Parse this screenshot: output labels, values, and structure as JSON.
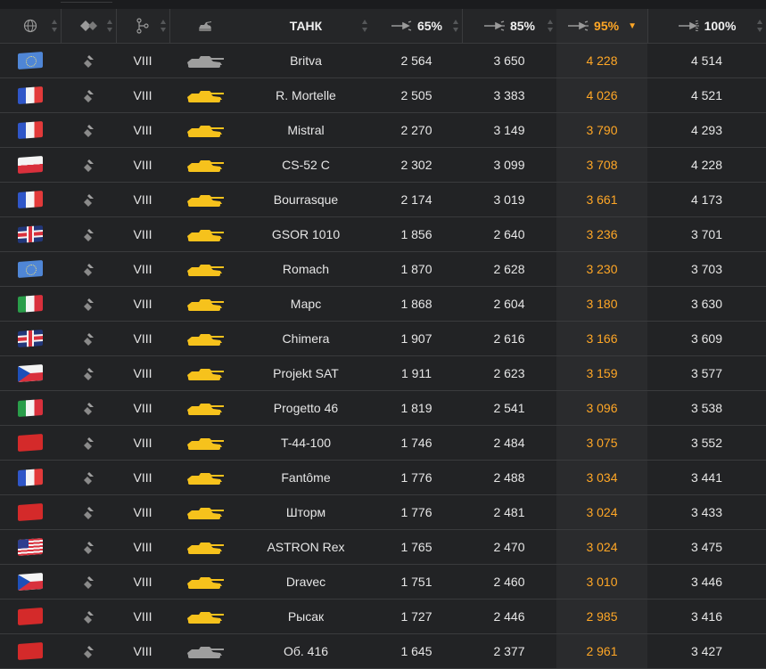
{
  "header": {
    "tank_label": "ТАНК",
    "col_65": "65%",
    "col_85": "85%",
    "col_95": "95%",
    "col_100": "100%",
    "sort_indicator": "▼"
  },
  "icons": {
    "nation": "globe-icon",
    "type": "tank-type-icon",
    "tier": "tech-tree-icon",
    "vehicle": "tank-silhouette-icon",
    "mark": "gun-mark-icon",
    "class": "medium-tank-chevron-icon"
  },
  "colors": {
    "accent": "#ffa726",
    "tank_gold": "#f6c21c",
    "tank_grey": "#9e9e9e",
    "row_bg": "#222325",
    "highlight_col_bg": "#2a2b2d"
  },
  "rows": [
    {
      "nation": "eu",
      "tier": "VIII",
      "name": "Britva",
      "v65": "2 564",
      "v85": "3 650",
      "v95": "4 228",
      "v100": "4 514",
      "premium": false
    },
    {
      "nation": "fr",
      "tier": "VIII",
      "name": "R. Mortelle",
      "v65": "2 505",
      "v85": "3 383",
      "v95": "4 026",
      "v100": "4 521",
      "premium": true
    },
    {
      "nation": "fr",
      "tier": "VIII",
      "name": "Mistral",
      "v65": "2 270",
      "v85": "3 149",
      "v95": "3 790",
      "v100": "4 293",
      "premium": true
    },
    {
      "nation": "pl",
      "tier": "VIII",
      "name": "CS-52 C",
      "v65": "2 302",
      "v85": "3 099",
      "v95": "3 708",
      "v100": "4 228",
      "premium": true
    },
    {
      "nation": "fr",
      "tier": "VIII",
      "name": "Bourrasque",
      "v65": "2 174",
      "v85": "3 019",
      "v95": "3 661",
      "v100": "4 173",
      "premium": true
    },
    {
      "nation": "uk",
      "tier": "VIII",
      "name": "GSOR 1010",
      "v65": "1 856",
      "v85": "2 640",
      "v95": "3 236",
      "v100": "3 701",
      "premium": true
    },
    {
      "nation": "eu",
      "tier": "VIII",
      "name": "Romach",
      "v65": "1 870",
      "v85": "2 628",
      "v95": "3 230",
      "v100": "3 703",
      "premium": true
    },
    {
      "nation": "it",
      "tier": "VIII",
      "name": "Марс",
      "v65": "1 868",
      "v85": "2 604",
      "v95": "3 180",
      "v100": "3 630",
      "premium": true
    },
    {
      "nation": "uk",
      "tier": "VIII",
      "name": "Chimera",
      "v65": "1 907",
      "v85": "2 616",
      "v95": "3 166",
      "v100": "3 609",
      "premium": true
    },
    {
      "nation": "cz",
      "tier": "VIII",
      "name": "Projekt SAT",
      "v65": "1 911",
      "v85": "2 623",
      "v95": "3 159",
      "v100": "3 577",
      "premium": true
    },
    {
      "nation": "it",
      "tier": "VIII",
      "name": "Progetto 46",
      "v65": "1 819",
      "v85": "2 541",
      "v95": "3 096",
      "v100": "3 538",
      "premium": true
    },
    {
      "nation": "ussr",
      "tier": "VIII",
      "name": "T-44-100",
      "v65": "1 746",
      "v85": "2 484",
      "v95": "3 075",
      "v100": "3 552",
      "premium": true
    },
    {
      "nation": "fr",
      "tier": "VIII",
      "name": "Fantôme",
      "v65": "1 776",
      "v85": "2 488",
      "v95": "3 034",
      "v100": "3 441",
      "premium": true
    },
    {
      "nation": "ussr",
      "tier": "VIII",
      "name": "Шторм",
      "v65": "1 776",
      "v85": "2 481",
      "v95": "3 024",
      "v100": "3 433",
      "premium": true
    },
    {
      "nation": "us",
      "tier": "VIII",
      "name": "ASTRON Rex",
      "v65": "1 765",
      "v85": "2 470",
      "v95": "3 024",
      "v100": "3 475",
      "premium": true
    },
    {
      "nation": "cz",
      "tier": "VIII",
      "name": "Dravec",
      "v65": "1 751",
      "v85": "2 460",
      "v95": "3 010",
      "v100": "3 446",
      "premium": true
    },
    {
      "nation": "ussr",
      "tier": "VIII",
      "name": "Рысак",
      "v65": "1 727",
      "v85": "2 446",
      "v95": "2 985",
      "v100": "3 416",
      "premium": true
    },
    {
      "nation": "ussr",
      "tier": "VIII",
      "name": "Об. 416",
      "v65": "1 645",
      "v85": "2 377",
      "v95": "2 961",
      "v100": "3 427",
      "premium": false
    }
  ]
}
